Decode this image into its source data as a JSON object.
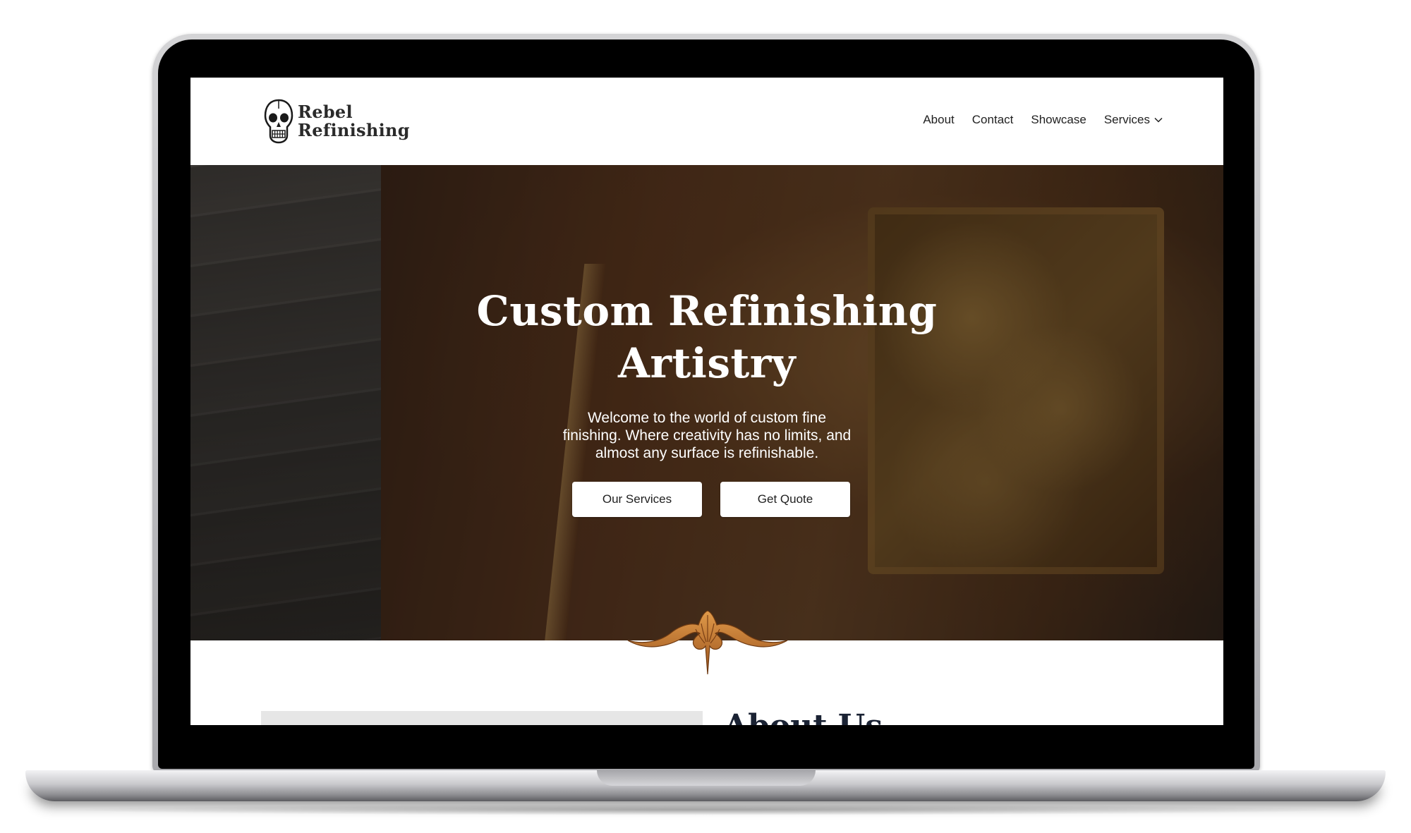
{
  "brand": {
    "name_line1": "Rebel",
    "name_line2": "Refinishing",
    "logo_icon": "skull-icon"
  },
  "nav": {
    "items": [
      {
        "label": "About"
      },
      {
        "label": "Contact"
      },
      {
        "label": "Showcase"
      },
      {
        "label": "Services",
        "icon": "chevron-down-icon"
      }
    ]
  },
  "hero": {
    "title": "Custom Refinishing Artistry",
    "subtitle": "Welcome to the world of custom fine finishing. Where creativity has no limits, and almost any surface is refinishable.",
    "buttons": {
      "primary": "Our Services",
      "secondary": "Get Quote"
    }
  },
  "about": {
    "heading": "About Us"
  },
  "colors": {
    "text_dark": "#1f1f1f",
    "heading_navy": "#1a2233",
    "ornament_copper": "#c8782a",
    "button_bg": "#ffffff"
  }
}
